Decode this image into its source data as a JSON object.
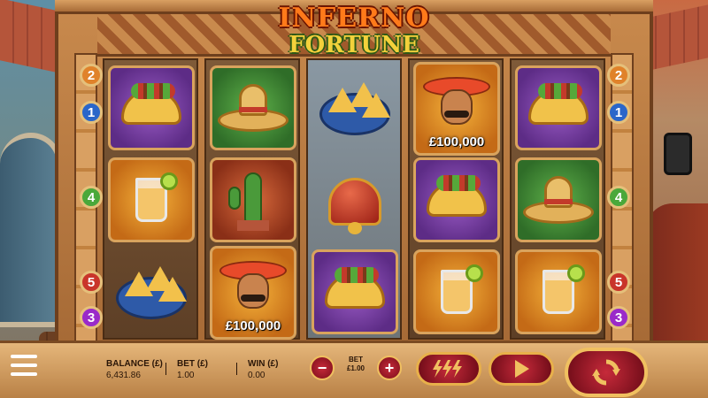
{
  "game": {
    "title_line1": "INFERNO",
    "title_line2": "FORTUNE"
  },
  "paylines": {
    "left": [
      "2",
      "1",
      "4",
      "5",
      "3"
    ],
    "right": [
      "2",
      "1",
      "4",
      "5",
      "3"
    ]
  },
  "reels": [
    [
      "taco",
      "margarita",
      "nachos"
    ],
    [
      "sombrero",
      "cactus",
      "mariachi-prize"
    ],
    [
      "nachos",
      "bell",
      "taco"
    ],
    [
      "mariachi-prize",
      "taco",
      "margarita"
    ],
    [
      "taco",
      "sombrero",
      "margarita"
    ]
  ],
  "prizes": {
    "reel2_bottom": "£100,000",
    "reel4_top": "£100,000"
  },
  "controls": {
    "balance_label": "BALANCE (£)",
    "balance_value": "6,431.86",
    "bet_label": "BET (£)",
    "bet_value": "1.00",
    "win_label": "WIN (£)",
    "win_value": "0.00",
    "stake_label": "BET",
    "stake_value": "£1.00",
    "minus": "−",
    "plus": "+"
  },
  "icons": {
    "menu": "hamburger-icon",
    "turbo": "lightning-icon",
    "autoplay": "play-icon",
    "spin": "refresh-icon"
  },
  "colors": {
    "button_red": "#c62a3a",
    "frame_gold": "#f0c060",
    "prize_text": "#ffffff"
  }
}
